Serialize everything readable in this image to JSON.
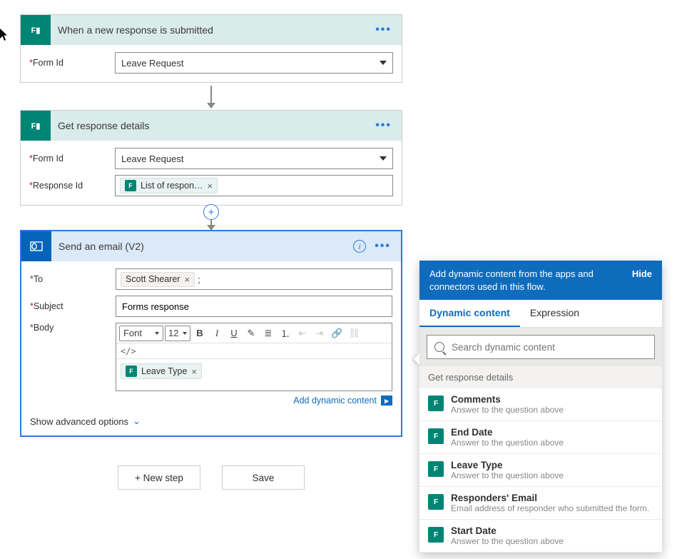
{
  "colors": {
    "forms": "#008575",
    "outlook": "#0364b8",
    "accent": "#0f6cbd"
  },
  "cards": {
    "trigger": {
      "title": "When a new response is submitted",
      "formIdLabel": "Form Id",
      "formIdValue": "Leave Request"
    },
    "getDetails": {
      "title": "Get response details",
      "formIdLabel": "Form Id",
      "formIdValue": "Leave Request",
      "responseIdLabel": "Response Id",
      "responseToken": "List of respon…"
    },
    "email": {
      "title": "Send an email (V2)",
      "toLabel": "To",
      "toPerson": "Scott Shearer",
      "subjectLabel": "Subject",
      "subjectValue": "Forms response",
      "bodyLabel": "Body",
      "fontLabel": "Font",
      "fontSize": "12",
      "codeToggle": "</>",
      "bodyToken": "Leave Type",
      "addDynamic": "Add dynamic content",
      "advanced": "Show advanced options"
    }
  },
  "buttons": {
    "newStep": "+ New step",
    "save": "Save"
  },
  "dyn": {
    "headerText": "Add dynamic content from the apps and connectors used in this flow.",
    "hide": "Hide",
    "tabs": {
      "dynamic": "Dynamic content",
      "expression": "Expression"
    },
    "searchPlaceholder": "Search dynamic content",
    "sectionTitle": "Get response details",
    "items": [
      {
        "name": "Comments",
        "desc": "Answer to the question above"
      },
      {
        "name": "End Date",
        "desc": "Answer to the question above"
      },
      {
        "name": "Leave Type",
        "desc": "Answer to the question above"
      },
      {
        "name": "Responders' Email",
        "desc": "Email address of responder who submitted the form."
      },
      {
        "name": "Start Date",
        "desc": "Answer to the question above"
      }
    ]
  }
}
